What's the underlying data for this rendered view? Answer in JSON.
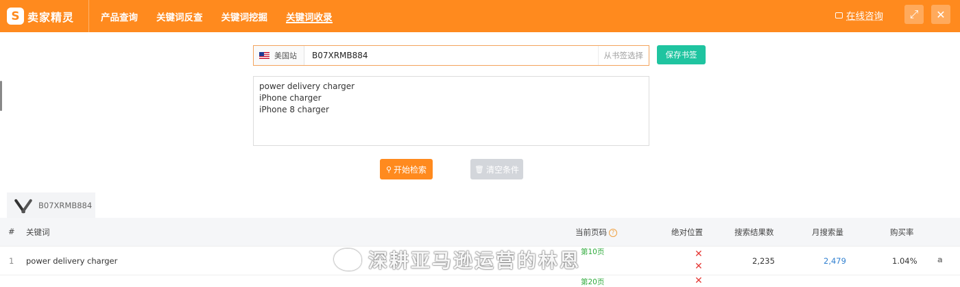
{
  "header": {
    "logo_mark": "S",
    "logo_text": "卖家精灵",
    "nav": [
      "产品查询",
      "关键词反查",
      "关键词挖掘",
      "关键词收录"
    ],
    "active_nav_index": 3,
    "consult": "在线咨询",
    "expand_icon": "⤢",
    "close_icon": "✕"
  },
  "search": {
    "site": "美国站",
    "asin_value": "B07XRMB884",
    "bookmark_select": "从书签选择",
    "save_button": "保存书签",
    "keywords": [
      "power delivery charger",
      "iPhone charger",
      "iPhone 8 charger"
    ],
    "start_button": "开始检索",
    "clear_button": "清空条件"
  },
  "product_tab": {
    "asin": "B07XRMB884"
  },
  "table": {
    "headers": {
      "index": "#",
      "keyword": "关键词",
      "current_page": "当前页码",
      "absolute_position": "绝对位置",
      "search_results": "搜索结果数",
      "monthly_search": "月搜索量",
      "purchase_rate": "购买率"
    },
    "help_icon": "?",
    "rows": [
      {
        "index": "1",
        "keyword": "power delivery charger",
        "pages": [
          "第10页",
          "第20页"
        ],
        "absolute_position": "✕",
        "search_results": "2,235",
        "monthly_search": "2,479",
        "purchase_rate": "1.04%",
        "amazon_icon": "a"
      }
    ],
    "next_row_page": "第20页"
  },
  "watermark": "深耕亚马逊运营的林恩",
  "colors": {
    "primary": "#ff8a1e",
    "teal": "#1fc4a0",
    "link_blue": "#2f7fd0",
    "green": "#2eaa3b",
    "red": "#e53935"
  }
}
